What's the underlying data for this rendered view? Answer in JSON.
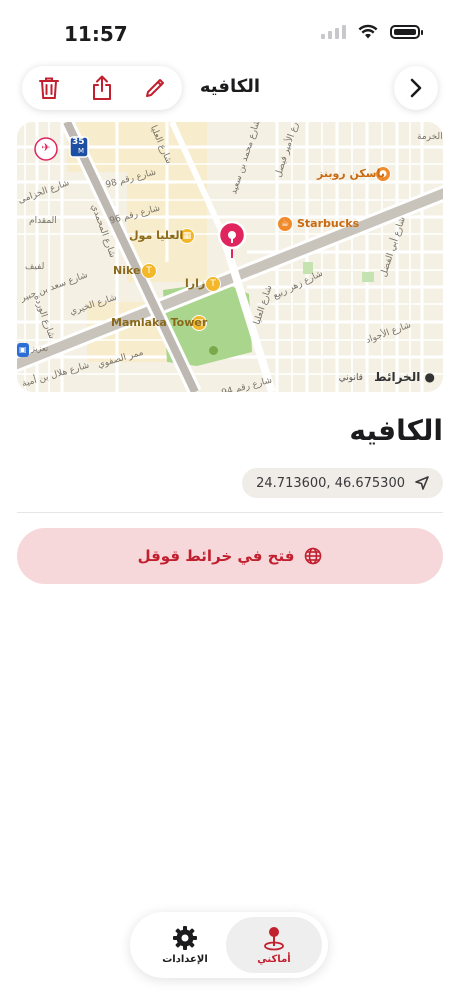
{
  "status_bar": {
    "time": "11:57"
  },
  "nav": {
    "title": "الكافيه"
  },
  "map": {
    "streets": {
      "olaya_1": "شارع العليا",
      "olaya_2": "شارع العليا",
      "street_96": "شارع رقم 96",
      "street_98": "شارع رقم 98",
      "street_94": "شارع رقم 94",
      "khuzama": "شارع الخزامى",
      "maqdam": "المقدام",
      "mohammadi": "شارع المحمدي",
      "said": "شارع محمد بن سعيد",
      "lafif": "لفيف",
      "saad": "شارع سعد بن جبير",
      "ward": "شارع الوردة",
      "khairi": "شارع الخيري",
      "safwa": "ممر الصفوي",
      "hilal": "شارع هلال بن أمية",
      "zahr": "شارع زهر ربيع",
      "faisal": "شارع أبي الفضل",
      "ajwad": "شارع الأجواد",
      "amir": "شارع الأمير فيصل",
      "kharma": "الخرمة"
    },
    "route_shield": "35",
    "route_shield_sub": "M",
    "pois": {
      "baskin": "باسكن روبنز",
      "starbucks": "Starbucks",
      "olaya_mall": "العليا مول",
      "nike": "Nike",
      "zara": "زارا",
      "mamlaka": "Mamlaka Tower"
    },
    "maps_logo": "الخرائط",
    "legal": "قانوني",
    "fuel_label": "تعزيز"
  },
  "place": {
    "title": "الكافيه",
    "coordinates": "24.713600, 46.675300"
  },
  "actions": {
    "open_google_maps": "فتح في خرائط قوقل"
  },
  "tabs": [
    {
      "label": "أماكني"
    },
    {
      "label": "الإعدادات"
    }
  ],
  "colors": {
    "accent": "#c21f2f",
    "pin": "#e0245e",
    "map_bg": "#f5f0e4"
  }
}
